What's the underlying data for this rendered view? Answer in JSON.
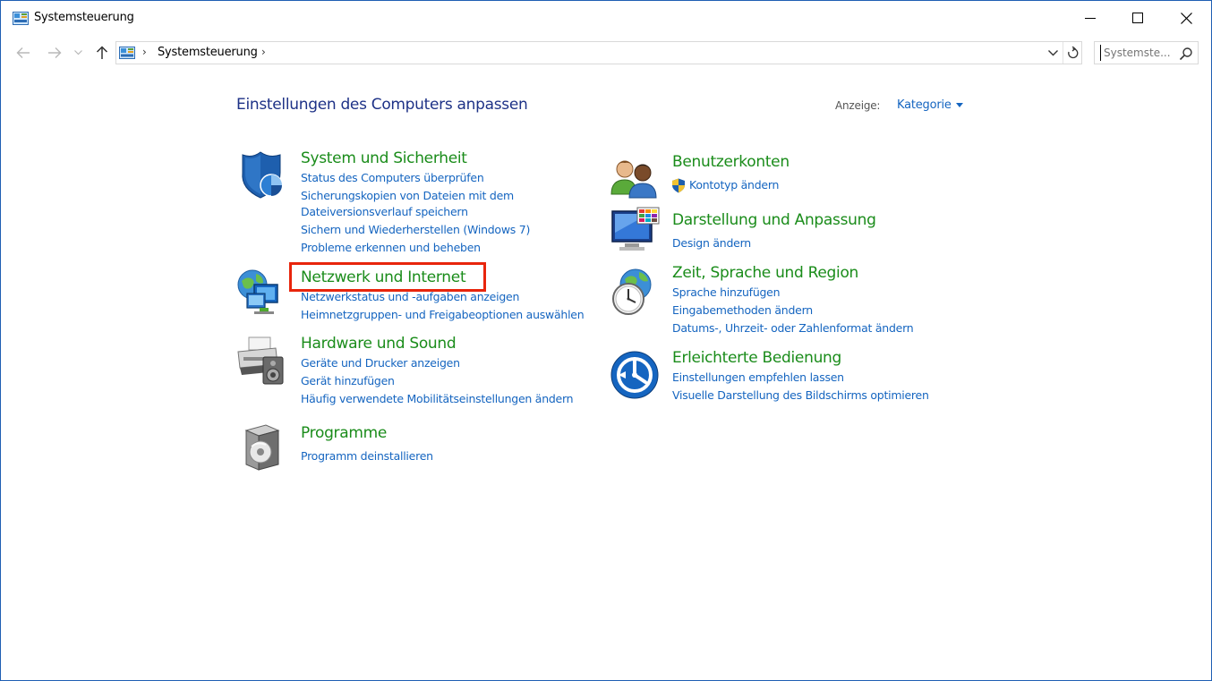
{
  "window": {
    "title": "Systemsteuerung"
  },
  "address": {
    "crumb": "Systemsteuerung",
    "search_placeholder": "Systemste..."
  },
  "content": {
    "heading": "Einstellungen des Computers anpassen",
    "view_label": "Anzeige:",
    "view_value": "Kategorie"
  },
  "categories": {
    "system": {
      "title": "System und Sicherheit",
      "links": [
        "Status des Computers überprüfen",
        "Sicherungskopien von Dateien mit dem",
        "Dateiversionsverlauf speichern",
        "Sichern und Wiederherstellen (Windows 7)",
        "Probleme erkennen und beheben"
      ]
    },
    "network": {
      "title": "Netzwerk und Internet",
      "links": [
        "Netzwerkstatus und -aufgaben anzeigen",
        "Heimnetzgruppen- und Freigabeoptionen auswählen"
      ]
    },
    "hardware": {
      "title": "Hardware und Sound",
      "links": [
        "Geräte und Drucker anzeigen",
        "Gerät hinzufügen",
        "Häufig verwendete Mobilitätseinstellungen ändern"
      ]
    },
    "programs": {
      "title": "Programme",
      "links": [
        "Programm deinstallieren"
      ]
    },
    "accounts": {
      "title": "Benutzerkonten",
      "links": [
        "Kontotyp ändern"
      ]
    },
    "appearance": {
      "title": "Darstellung und Anpassung",
      "links": [
        "Design ändern"
      ]
    },
    "region": {
      "title": "Zeit, Sprache und Region",
      "links": [
        "Sprache hinzufügen",
        "Eingabemethoden ändern",
        "Datums-, Uhrzeit- oder Zahlenformat ändern"
      ]
    },
    "ease": {
      "title": "Erleichterte Bedienung",
      "links": [
        "Einstellungen empfehlen lassen",
        "Visuelle Darstellung des Bildschirms optimieren"
      ]
    }
  },
  "colors": {
    "category_title": "#1a8c1a",
    "link": "#1565c0",
    "heading": "#1e3287",
    "highlight": "#e8250c"
  },
  "icons": {
    "app": "control-panel-icon",
    "back": "back-arrow-icon",
    "forward": "forward-arrow-icon",
    "recent": "recent-dropdown-icon",
    "up": "up-arrow-icon",
    "refresh": "refresh-icon",
    "search": "search-icon"
  }
}
